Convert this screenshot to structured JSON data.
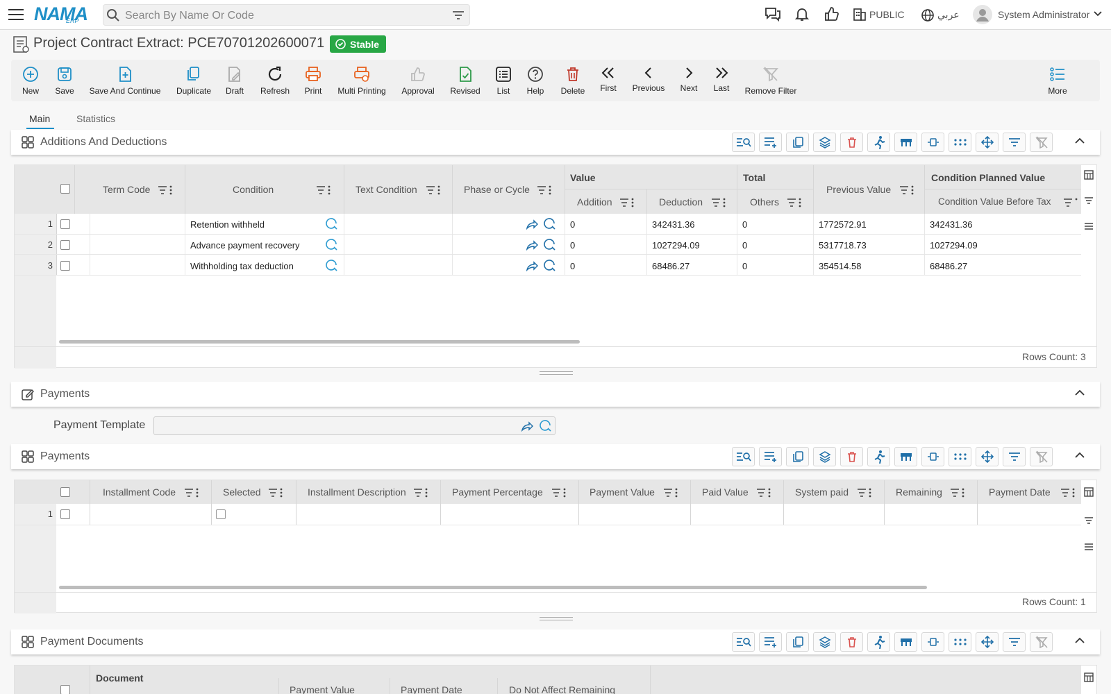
{
  "app": {
    "logo": "NAMA",
    "logo_sub": "ERP"
  },
  "search": {
    "placeholder": "Search By Name Or Code"
  },
  "topbar": {
    "branch": "PUBLIC",
    "language": "عربي",
    "user": "System Administrator"
  },
  "page": {
    "title": "Project Contract Extract: PCE70701202600071",
    "status": "Stable"
  },
  "toolbar": [
    {
      "label": "New",
      "icon": "plus-circle-icon"
    },
    {
      "label": "Save",
      "icon": "save-icon"
    },
    {
      "label": "Save And Continue",
      "icon": "file-plus-icon"
    },
    {
      "label": "Duplicate",
      "icon": "copy-icon"
    },
    {
      "label": "Draft",
      "icon": "draft-icon"
    },
    {
      "label": "Refresh",
      "icon": "refresh-icon"
    },
    {
      "label": "Print",
      "icon": "printer-icon"
    },
    {
      "label": "Multi Printing",
      "icon": "multi-print-icon"
    },
    {
      "label": "Approval",
      "icon": "thumbs-up-icon"
    },
    {
      "label": "Revised",
      "icon": "file-check-icon"
    },
    {
      "label": "List",
      "icon": "list-icon"
    },
    {
      "label": "Help",
      "icon": "help-icon"
    },
    {
      "label": "Delete",
      "icon": "trash-icon"
    },
    {
      "label": "First",
      "icon": "double-chevron-left-icon"
    },
    {
      "label": "Previous",
      "icon": "chevron-left-icon"
    },
    {
      "label": "Next",
      "icon": "chevron-right-icon"
    },
    {
      "label": "Last",
      "icon": "double-chevron-right-icon"
    },
    {
      "label": "Remove Filter",
      "icon": "filter-off-icon"
    },
    {
      "label": "More",
      "icon": "more-list-icon"
    }
  ],
  "tabs": [
    {
      "label": "Main"
    },
    {
      "label": "Statistics"
    }
  ],
  "sections": {
    "additions": "Additions And Deductions",
    "payments_form": "Payments",
    "payments_grid": "Payments",
    "documents": "Payment Documents"
  },
  "additions_grid": {
    "headers": {
      "term_code": "Term Code",
      "condition": "Condition",
      "text_condition": "Text Condition",
      "phase": "Phase or Cycle",
      "value_group": "Value",
      "addition": "Addition",
      "deduction": "Deduction",
      "total_group": "Total",
      "others": "Others",
      "previous_value": "Previous Value",
      "planned_group": "Condition Planned Value",
      "before_tax": "Condition Value Before Tax"
    },
    "rows": [
      {
        "no": "1",
        "condition": "Retention withheld",
        "addition": "0",
        "deduction": "342431.36",
        "others": "0",
        "previous": "1772572.91",
        "before_tax": "342431.36"
      },
      {
        "no": "2",
        "condition": "Advance payment recovery",
        "addition": "0",
        "deduction": "1027294.09",
        "others": "0",
        "previous": "5317718.73",
        "before_tax": "1027294.09"
      },
      {
        "no": "3",
        "condition": "Withholding tax deduction",
        "addition": "0",
        "deduction": "68486.27",
        "others": "0",
        "previous": "354514.58",
        "before_tax": "68486.27"
      }
    ],
    "rows_count": "Rows Count: 3"
  },
  "payment_template": {
    "label": "Payment Template",
    "value": ""
  },
  "payments_grid": {
    "headers": [
      "Installment Code",
      "Selected",
      "Installment Description",
      "Payment Percentage",
      "Payment Value",
      "Paid Value",
      "System paid",
      "Remaining",
      "Payment Date"
    ],
    "rows": [
      {
        "no": "1"
      }
    ],
    "rows_count": "Rows Count: 1"
  },
  "documents_grid": {
    "headers": {
      "document_group": "Document",
      "payment_value": "Payment Value",
      "payment_date": "Payment Date",
      "not_affect": "Do Not Affect Remaining"
    }
  }
}
